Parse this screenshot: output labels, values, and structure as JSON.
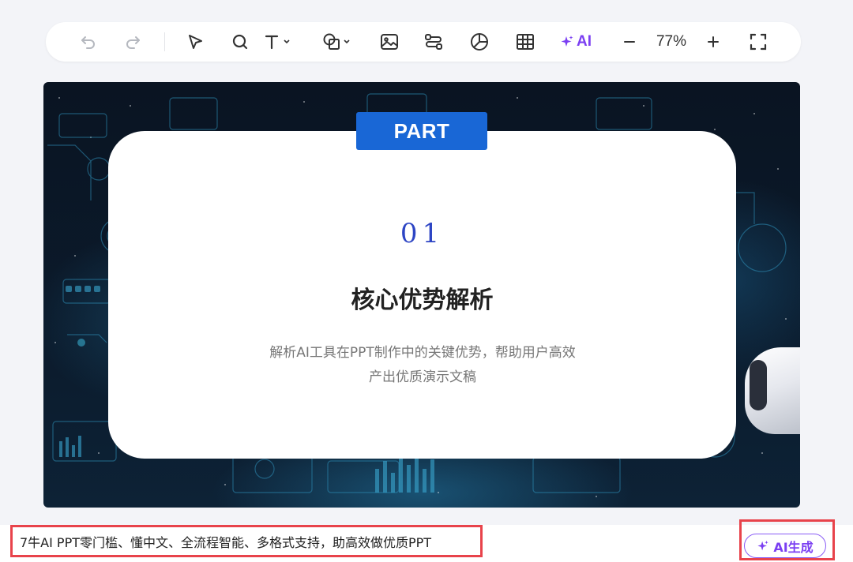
{
  "toolbar": {
    "items": [
      {
        "icon": "undo-icon"
      },
      {
        "icon": "redo-icon"
      },
      {
        "icon": "select-pointer-icon"
      },
      {
        "icon": "search-icon"
      },
      {
        "icon": "text-icon"
      },
      {
        "icon": "shape-icon"
      },
      {
        "icon": "image-icon"
      },
      {
        "icon": "flow-connector-icon"
      },
      {
        "icon": "pie-chart-icon"
      },
      {
        "icon": "table-icon"
      },
      {
        "icon": "sparkle-icon"
      },
      {
        "icon": "zoom-out-icon"
      },
      {
        "icon": "zoom-in-icon"
      },
      {
        "icon": "fullscreen-icon"
      }
    ],
    "ai_label": "AI",
    "zoom_level": "77%"
  },
  "slide": {
    "part_label": "PART",
    "section_number": "01",
    "section_title": "核心优势解析",
    "description_line1": "解析AI工具在PPT制作中的关键优势，帮助用户高效",
    "description_line2": "产出优质演示文稿"
  },
  "bottom": {
    "prompt_text": "7牛AI PPT零门槛、懂中文、全流程智能、多格式支持，助高效做优质PPT",
    "generate_label": "AI生成"
  },
  "colors": {
    "accent_purple": "#7b3ff2",
    "part_blue": "#1967d6",
    "number_blue": "#2d45c4",
    "highlight_red": "#e8434b"
  }
}
